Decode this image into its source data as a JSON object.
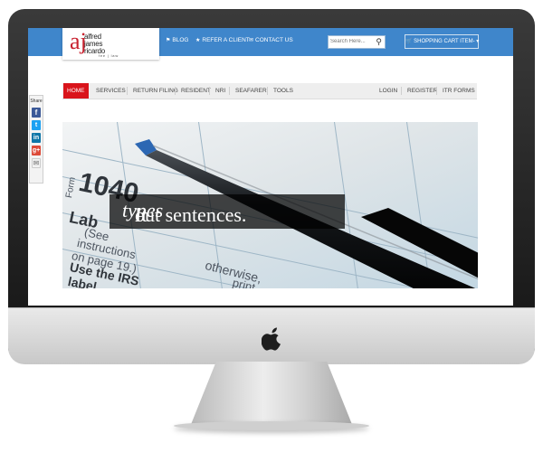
{
  "logo": {
    "initials": "aj",
    "name_line1": "alfred",
    "name_line2": "james",
    "name_line3": "ricardo",
    "tagline": "fee | law"
  },
  "topbar": {
    "links": [
      {
        "icon": "bookmark-icon",
        "label": "BLOG"
      },
      {
        "icon": "star-icon",
        "label": "REFER A CLIENT"
      },
      {
        "icon": "contact-card-icon",
        "label": "CONTACT US"
      }
    ],
    "search_placeholder": "Search Here...",
    "cart_label": "SHOPPING CART ITEM-"
  },
  "share": {
    "label": "Share",
    "buttons": [
      "facebook-icon",
      "twitter-icon",
      "linkedin-icon",
      "google-plus-icon",
      "email-icon"
    ]
  },
  "nav": {
    "items": [
      "HOME",
      "SERVICES",
      "RETURN FILING",
      "RESIDENT",
      "NRI",
      "SEAFARER",
      "TOOLS"
    ],
    "active": "HOME",
    "right_items": [
      "LOGIN",
      "REGISTER",
      "ITR FORMS"
    ]
  },
  "hero": {
    "caption_pre": "It ",
    "caption_em": "types",
    "caption_post": " out sentences.",
    "form_number": "1040",
    "form_prefix": "Form",
    "form_lines": [
      "Lab",
      "(See",
      "instructions",
      "on page 19.)",
      "Use the IRS",
      "label.",
      "otherwise,",
      "print"
    ]
  },
  "colors": {
    "topbar": "#3f86cb",
    "nav_active": "#d9141b",
    "logo_red": "#c8202e"
  }
}
